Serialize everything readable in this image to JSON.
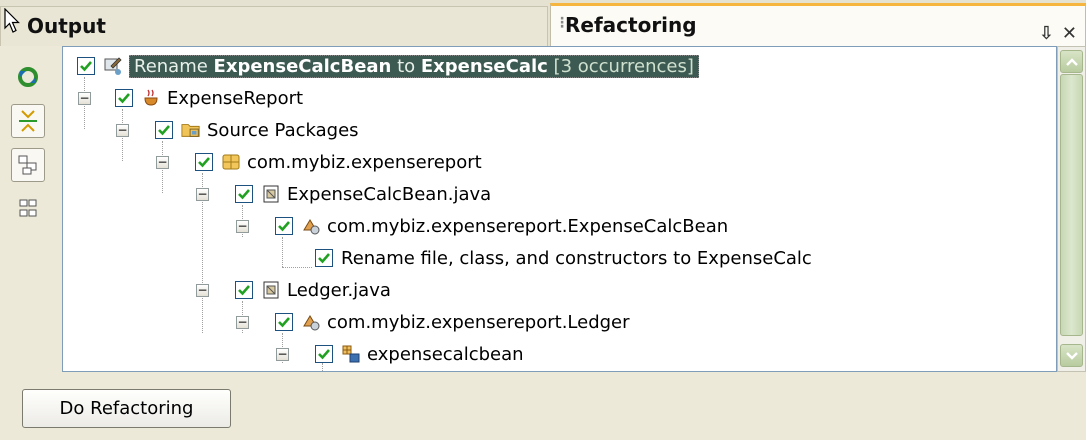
{
  "tabs": {
    "output_label": "Output",
    "refactoring_label": "Refactoring"
  },
  "tab_controls": {
    "minimize_glyph": "⇩",
    "close_glyph": "✕"
  },
  "tree": {
    "root": {
      "prefix": "Rename ",
      "old_name": "ExpenseCalcBean",
      "mid": " to ",
      "new_name": "ExpenseCalc",
      "occurrences": " [3 occurrences]"
    },
    "project": "ExpenseReport",
    "source_packages": "Source Packages",
    "package": "com.mybiz.expensereport",
    "file1": "ExpenseCalcBean.java",
    "class1": "com.mybiz.expensereport.ExpenseCalcBean",
    "action1": "Rename file, class, and constructors to ExpenseCalc",
    "file2": "Ledger.java",
    "class2": "com.mybiz.expensereport.Ledger",
    "field1": "expensecalcbean"
  },
  "buttons": {
    "do_refactoring": "Do Refactoring"
  },
  "colors": {
    "active_tab_accent": "#f6b53f",
    "root_highlight": "#3d5a52",
    "checkbox_check": "#21a121"
  },
  "icons": [
    "refresh-icon",
    "next-occurrence-icon",
    "logical-view-icon",
    "physical-view-icon",
    "rename-icon",
    "project-icon",
    "source-packages-icon",
    "package-icon",
    "java-file-icon",
    "class-icon",
    "field-icon"
  ]
}
